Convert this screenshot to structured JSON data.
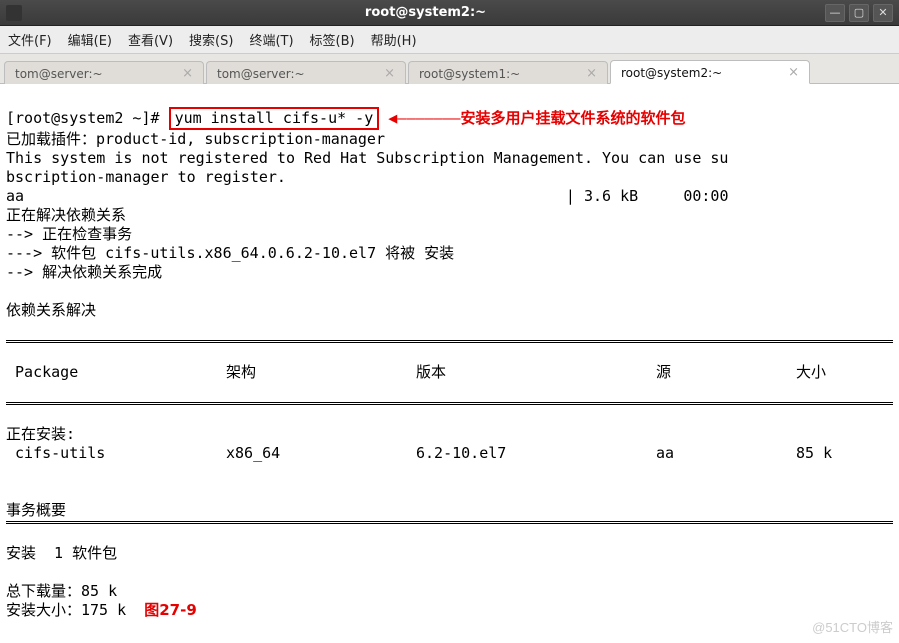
{
  "window": {
    "title": "root@system2:~"
  },
  "menu": {
    "file": "文件(F)",
    "edit": "编辑(E)",
    "view": "查看(V)",
    "search": "搜索(S)",
    "terminal": "终端(T)",
    "tabs": "标签(B)",
    "help": "帮助(H)"
  },
  "tabs": [
    {
      "label": "tom@server:~"
    },
    {
      "label": "tom@server:~"
    },
    {
      "label": "root@system1:~"
    },
    {
      "label": "root@system2:~"
    }
  ],
  "prompt": "[root@system2 ~]#",
  "command": "yum install cifs-u* -y",
  "annotation": "安装多用户挂载文件系统的软件包",
  "out": {
    "l1": "已加载插件：product-id, subscription-manager",
    "l2": "This system is not registered to Red Hat Subscription Management. You can use su",
    "l3": "bscription-manager to register.",
    "aa": "aa",
    "aa_size": "| 3.6 kB",
    "aa_time": "00:00",
    "l5": "正在解决依赖关系",
    "l6": "--> 正在检查事务",
    "l7": "---> 软件包 cifs-utils.x86_64.0.6.2-10.el7 将被 安装",
    "l8": "--> 解决依赖关系完成",
    "l9": "依赖关系解决"
  },
  "cols": {
    "pkg": " Package",
    "arch": "架构",
    "ver": "版本",
    "repo": "源",
    "size": "大小"
  },
  "install": {
    "heading": "正在安装:",
    "pkg": " cifs-utils",
    "arch": "x86_64",
    "ver": "6.2-10.el7",
    "repo": "aa",
    "size": "85 k"
  },
  "summary": {
    "title": "事务概要",
    "line": "安装  1 软件包",
    "dl": "总下载量：85 k",
    "inst": "安装大小：175 k"
  },
  "figure_label": "图27-9",
  "watermark": "@51CTO博客"
}
